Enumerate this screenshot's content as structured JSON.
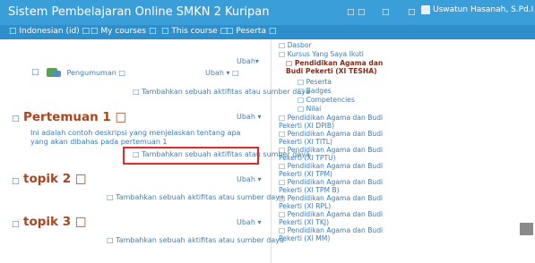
{
  "header": {
    "site_title": "Sistem Pembelajaran Online SMKN 2 Kuripan",
    "icons": [
      "□",
      "□",
      "□",
      "□"
    ],
    "user_name": "Uswatun Hasanah, S.Pd.I □"
  },
  "nav": {
    "items": [
      {
        "label": "□ Indonesian (id) □"
      },
      {
        "label": "□ My courses □"
      },
      {
        "label": "□ This course □"
      },
      {
        "label": "□ Peserta □"
      }
    ]
  },
  "main": {
    "top_section": {
      "edit_label": "Ubah",
      "edit_caret": "▾",
      "forum_prefix": "□",
      "forum_label": "Pengumuman □",
      "forum_edit": "Ubah ▾ □",
      "add_label": "□ Tambahkan sebuah aktifitas atau sumber daya"
    },
    "sections": [
      {
        "title": "Pertemuan 1 □",
        "prefix": "□",
        "edit_label": "Ubah ▾",
        "description": "Ini adalah contoh deskripsi yang menjelaskan tentang apa yang akan dibahas pada pertemuan 1",
        "add_label": "□ Tambahkan sebuah aktifitas atau sumber daya"
      },
      {
        "title": "topik 2 □",
        "prefix": "□",
        "edit_label": "Ubah ▾",
        "add_label": "□ Tambahkan sebuah aktifitas atau sumber daya"
      },
      {
        "title": "topik 3 □",
        "prefix": "□",
        "edit_label": "Ubah ▾",
        "add_label": "□ Tambahkan sebuah aktifitas atau sumber daya"
      }
    ]
  },
  "sidebar": {
    "items": [
      {
        "label": "□ Dasbor"
      },
      {
        "label": "□ Kursus Yang Saya Ikuti"
      },
      {
        "label": "□ Pendidikan Agama dan Budi Pekerti (XI TESHA)"
      },
      {
        "label": "□ Peserta"
      },
      {
        "label": "□ Badges"
      },
      {
        "label": "□ Competencies"
      },
      {
        "label": "□ Nilai"
      },
      {
        "label": "□ Pendidikan Agama dan Budi Pekerti (XI DPIB)"
      },
      {
        "label": "□ Pendidikan Agama dan Budi Pekerti (XI TITL)"
      },
      {
        "label": "□ Pendidikan Agama dan Budi Pekerti (XI TPTU)"
      },
      {
        "label": "□ Pendidikan Agama dan Budi Pekerti (XI TPM)"
      },
      {
        "label": "□ Pendidikan Agama dan Budi Pekerti (XI TPM B)"
      },
      {
        "label": "□ Pendidikan Agama dan Budi Pekerti (XI RPL)"
      },
      {
        "label": "□ Pendidikan Agama dan Budi Pekerti (XI TKJ)"
      },
      {
        "label": "□ Pendidikan Agama dan Budi Pekerti (XI MM)"
      }
    ]
  },
  "colors": {
    "header_bg": "#3a9fd8",
    "nav_bg": "#2f8fcb",
    "section_title": "#b0431d",
    "link": "#3a7cb8",
    "highlight": "#e32a2a"
  }
}
